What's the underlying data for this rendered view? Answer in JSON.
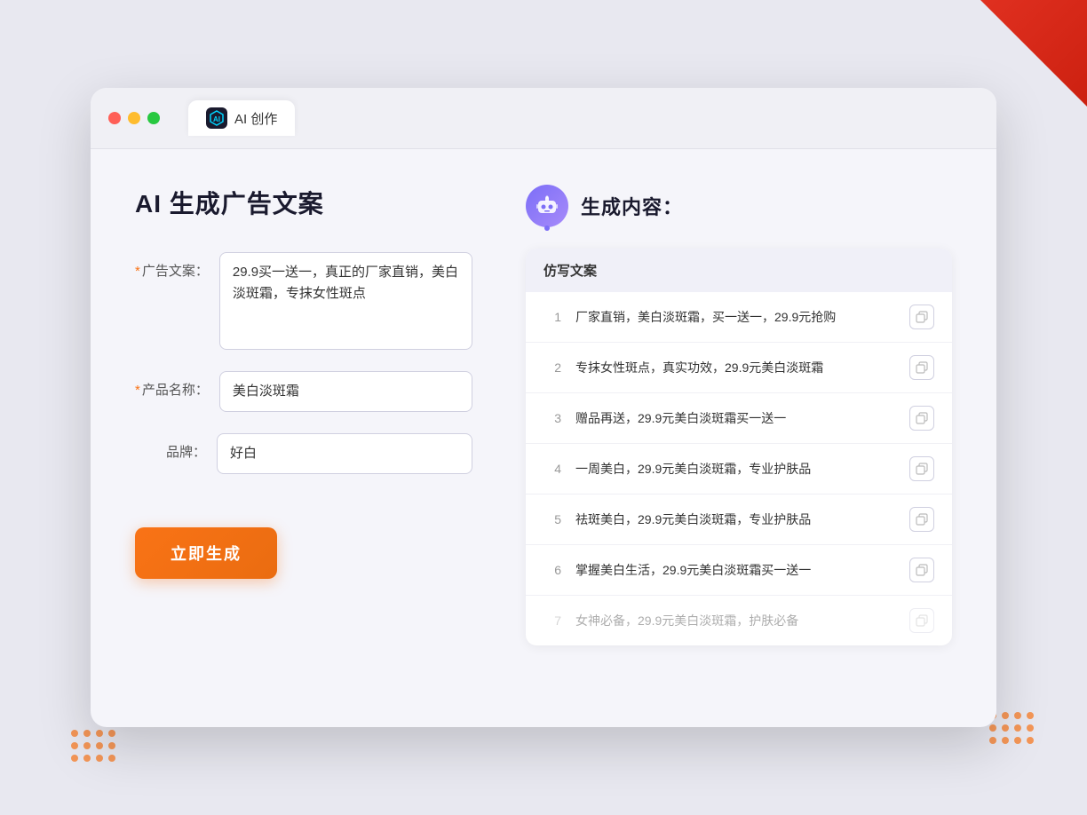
{
  "window": {
    "title": "AI 创作",
    "tab_icon": "AI"
  },
  "page": {
    "title": "AI 生成广告文案",
    "result_title": "生成内容："
  },
  "form": {
    "ad_copy_label": "广告文案：",
    "ad_copy_required": "*",
    "ad_copy_value": "29.9买一送一，真正的厂家直销，美白淡斑霜，专抹女性斑点",
    "product_name_label": "产品名称：",
    "product_name_required": "*",
    "product_name_value": "美白淡斑霜",
    "brand_label": "品牌：",
    "brand_value": "好白",
    "generate_button": "立即生成"
  },
  "results": {
    "table_header": "仿写文案",
    "items": [
      {
        "num": "1",
        "text": "厂家直销，美白淡斑霜，买一送一，29.9元抢购",
        "faded": false
      },
      {
        "num": "2",
        "text": "专抹女性斑点，真实功效，29.9元美白淡斑霜",
        "faded": false
      },
      {
        "num": "3",
        "text": "赠品再送，29.9元美白淡斑霜买一送一",
        "faded": false
      },
      {
        "num": "4",
        "text": "一周美白，29.9元美白淡斑霜，专业护肤品",
        "faded": false
      },
      {
        "num": "5",
        "text": "祛斑美白，29.9元美白淡斑霜，专业护肤品",
        "faded": false
      },
      {
        "num": "6",
        "text": "掌握美白生活，29.9元美白淡斑霜买一送一",
        "faded": false
      },
      {
        "num": "7",
        "text": "女神必备，29.9元美白淡斑霜，护肤必备",
        "faded": true
      }
    ]
  },
  "traffic_lights": {
    "red": "#ff5f57",
    "yellow": "#febc2e",
    "green": "#28c840"
  }
}
